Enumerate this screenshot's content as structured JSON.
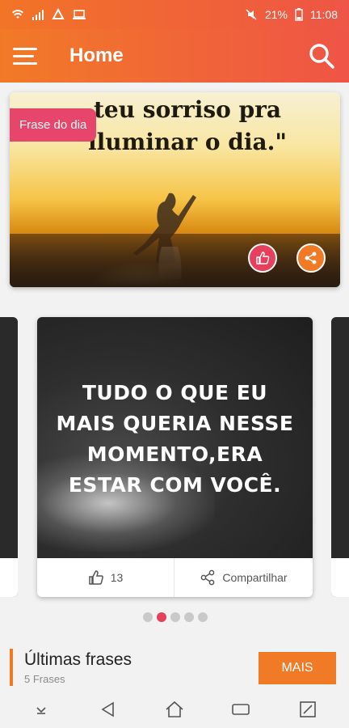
{
  "status_bar": {
    "battery": "21%",
    "time": "11:08",
    "icons": [
      "wifi-icon",
      "signal-icon",
      "app-icon",
      "laptop-icon",
      "mute-icon",
      "battery-icon"
    ]
  },
  "app_bar": {
    "title": "Home",
    "icons": [
      "menu-icon",
      "search-icon"
    ]
  },
  "featured": {
    "badge": "Frase do dia",
    "quote_line1": "teu sorriso pra",
    "quote_line2": "iluminar o dia.\"",
    "icons": [
      "thumbs-up-icon",
      "share-icon"
    ]
  },
  "carousel": {
    "quote": "TUDO O QUE EU\nMAIS QUERIA NESSE\nMOMENTO,ERA\nESTAR COM VOCÊ.",
    "likes": "13",
    "share_label": "Compartilhar",
    "pages": 5,
    "active_page": 2
  },
  "latest": {
    "title": "Últimas frases",
    "subtitle": "5 Frases",
    "button": "MAIS"
  },
  "colors": {
    "primary": "#f07a26",
    "accent": "#e6405c"
  }
}
